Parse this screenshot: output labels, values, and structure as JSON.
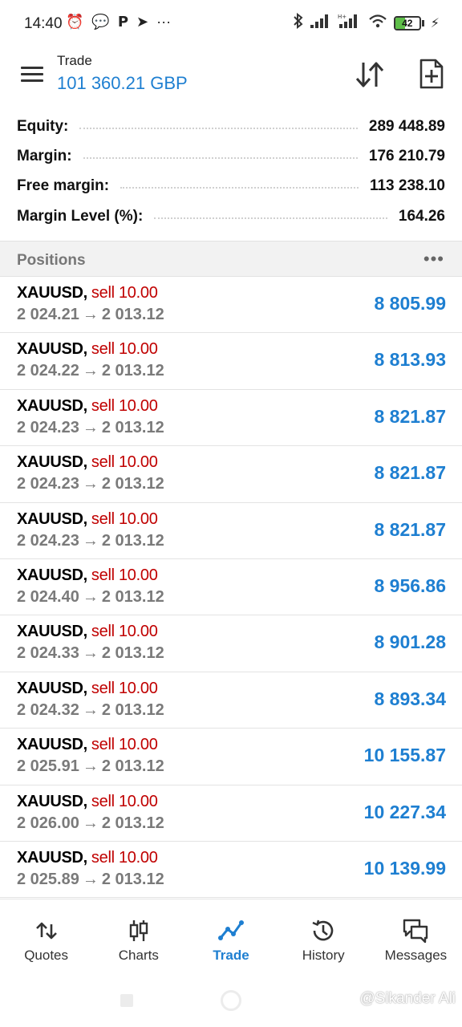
{
  "status_bar": {
    "time": "14:40",
    "battery_level": "42"
  },
  "app_bar": {
    "title": "Trade",
    "balance": "101 360.21 GBP"
  },
  "summary": [
    {
      "label": "Equity:",
      "value": "289 448.89"
    },
    {
      "label": "Margin:",
      "value": "176 210.79"
    },
    {
      "label": "Free margin:",
      "value": "113 238.10"
    },
    {
      "label": "Margin Level (%):",
      "value": "164.26"
    }
  ],
  "positions_section": {
    "title": "Positions",
    "more": "•••"
  },
  "positions": [
    {
      "symbol": "XAUUSD",
      "comma": ",",
      "side": "sell 10.00",
      "open": "2 024.21",
      "arrow": "→",
      "current": "2 013.12",
      "profit": "8 805.99"
    },
    {
      "symbol": "XAUUSD",
      "comma": ",",
      "side": "sell 10.00",
      "open": "2 024.22",
      "arrow": "→",
      "current": "2 013.12",
      "profit": "8 813.93"
    },
    {
      "symbol": "XAUUSD",
      "comma": ",",
      "side": "sell 10.00",
      "open": "2 024.23",
      "arrow": "→",
      "current": "2 013.12",
      "profit": "8 821.87"
    },
    {
      "symbol": "XAUUSD",
      "comma": ",",
      "side": "sell 10.00",
      "open": "2 024.23",
      "arrow": "→",
      "current": "2 013.12",
      "profit": "8 821.87"
    },
    {
      "symbol": "XAUUSD",
      "comma": ",",
      "side": "sell 10.00",
      "open": "2 024.23",
      "arrow": "→",
      "current": "2 013.12",
      "profit": "8 821.87"
    },
    {
      "symbol": "XAUUSD",
      "comma": ",",
      "side": "sell 10.00",
      "open": "2 024.40",
      "arrow": "→",
      "current": "2 013.12",
      "profit": "8 956.86"
    },
    {
      "symbol": "XAUUSD",
      "comma": ",",
      "side": "sell 10.00",
      "open": "2 024.33",
      "arrow": "→",
      "current": "2 013.12",
      "profit": "8 901.28"
    },
    {
      "symbol": "XAUUSD",
      "comma": ",",
      "side": "sell 10.00",
      "open": "2 024.32",
      "arrow": "→",
      "current": "2 013.12",
      "profit": "8 893.34"
    },
    {
      "symbol": "XAUUSD",
      "comma": ",",
      "side": "sell 10.00",
      "open": "2 025.91",
      "arrow": "→",
      "current": "2 013.12",
      "profit": "10 155.87"
    },
    {
      "symbol": "XAUUSD",
      "comma": ",",
      "side": "sell 10.00",
      "open": "2 026.00",
      "arrow": "→",
      "current": "2 013.12",
      "profit": "10 227.34"
    },
    {
      "symbol": "XAUUSD",
      "comma": ",",
      "side": "sell 10.00",
      "open": "2 025.89",
      "arrow": "→",
      "current": "2 013.12",
      "profit": "10 139.99"
    }
  ],
  "bottom_nav": [
    {
      "label": "Quotes",
      "icon": "quotes-icon",
      "active": false
    },
    {
      "label": "Charts",
      "icon": "charts-icon",
      "active": false
    },
    {
      "label": "Trade",
      "icon": "trade-icon",
      "active": true
    },
    {
      "label": "History",
      "icon": "history-icon",
      "active": false
    },
    {
      "label": "Messages",
      "icon": "messages-icon",
      "active": false
    }
  ],
  "watermark": "@Sikander Ali",
  "colors": {
    "accent": "#1e7fd1",
    "sell": "#c00000",
    "muted": "#7a7a7a"
  }
}
